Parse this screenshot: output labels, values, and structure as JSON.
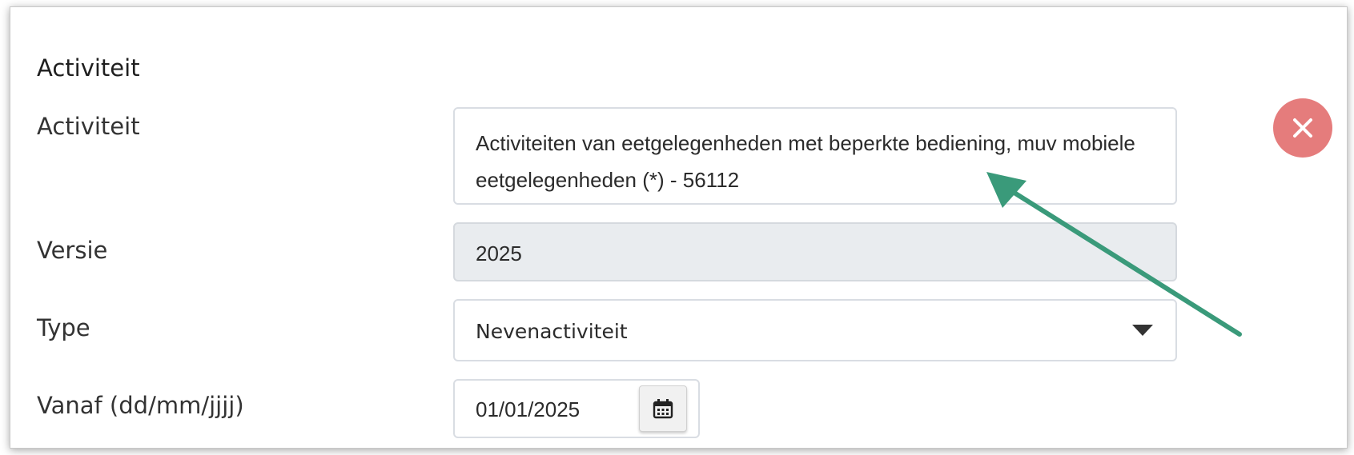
{
  "form": {
    "section_title": "Activiteit",
    "activity": {
      "label": "Activiteit",
      "value": "Activiteiten van eetgelegenheden met beperkte bediening, muv mobiele eetgelegenheden (*) - 56112"
    },
    "version": {
      "label": "Versie",
      "value": "2025"
    },
    "type": {
      "label": "Type",
      "selected": "Nevenactiviteit"
    },
    "from_date": {
      "label": "Vanaf (dd/mm/jjjj)",
      "value": "01/01/2025"
    }
  },
  "icons": {
    "remove": "close-icon",
    "calendar": "calendar-icon",
    "dropdown": "caret-down-icon",
    "annotation": "arrow-annotation"
  },
  "colors": {
    "remove_button": "#e57c7c",
    "readonly_background": "#e9ecef",
    "annotation_arrow": "#3a9a7a"
  }
}
